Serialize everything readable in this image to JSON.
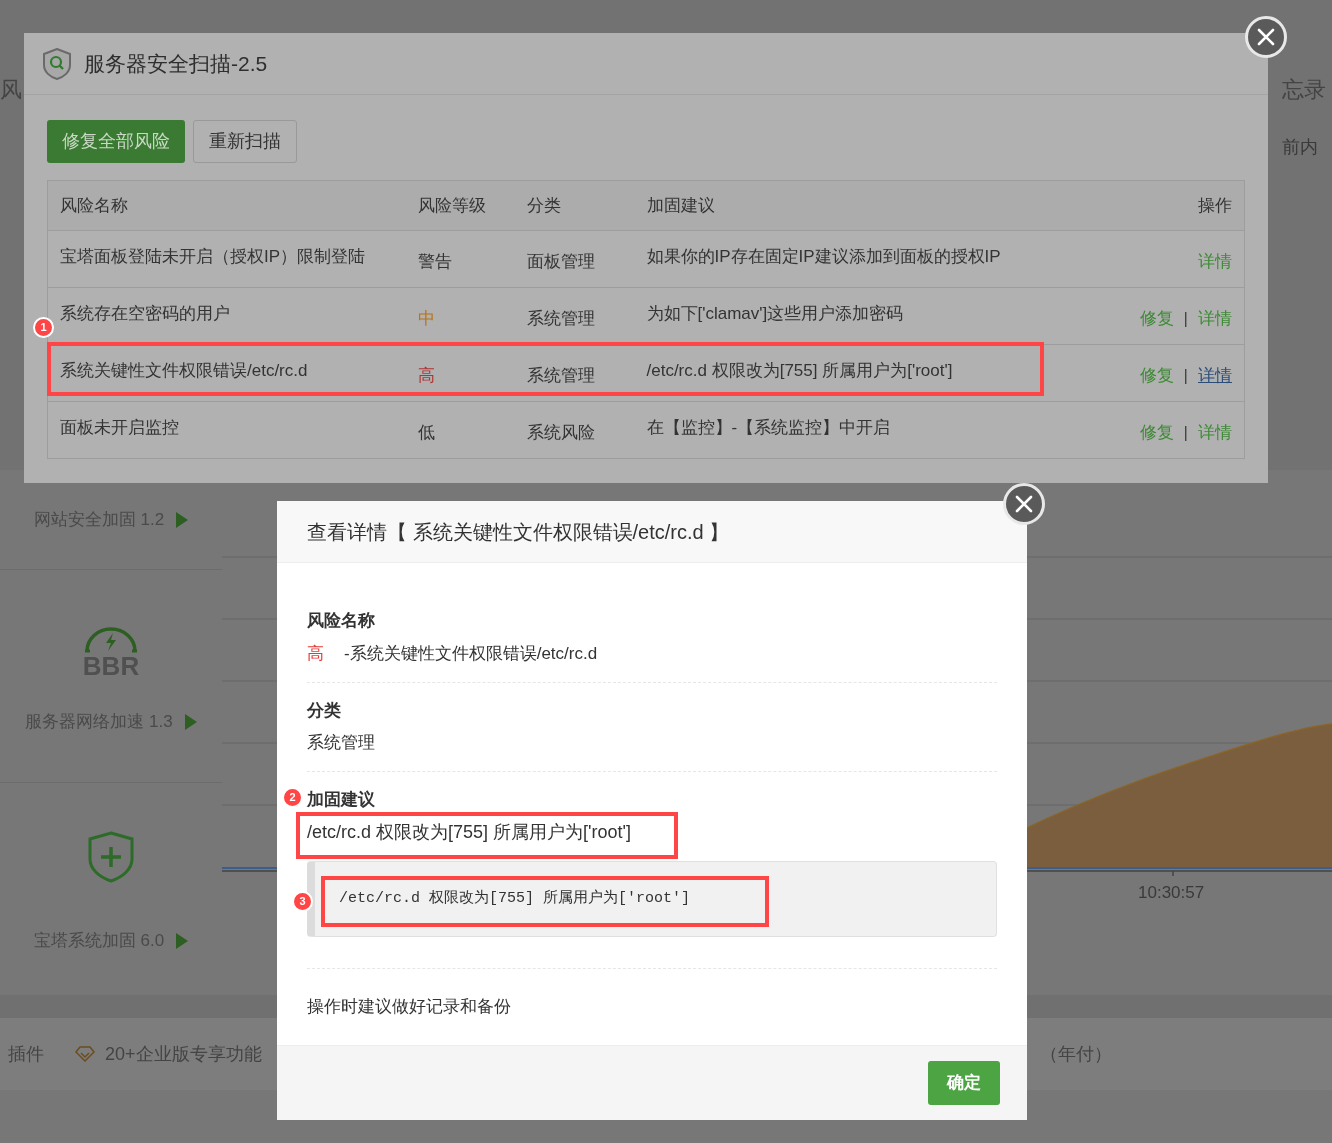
{
  "background": {
    "top_left_text": "风",
    "top_right_texts": [
      "忘录",
      "前内"
    ],
    "cards": [
      {
        "kind": "plain",
        "label": "网站安全加固 1.2"
      },
      {
        "kind": "bbr",
        "icon_text": "BBR",
        "label": "服务器网络加速 1.3"
      },
      {
        "kind": "shield",
        "label": "宝塔系统加固 6.0"
      }
    ],
    "chart": {
      "time_label": "10:30:57"
    },
    "bottom_bar": [
      {
        "kind": "text",
        "text": "插件"
      },
      {
        "kind": "diamond",
        "text": "20+企业版专享功能"
      },
      {
        "kind": "text",
        "text": "（年付）"
      }
    ]
  },
  "scan_dialog": {
    "title": "服务器安全扫描-2.5",
    "buttons": [
      {
        "kind": "primary",
        "label": "修复全部风险"
      },
      {
        "kind": "default",
        "label": "重新扫描"
      }
    ],
    "table": {
      "columns": [
        "风险名称",
        "风险等级",
        "分类",
        "加固建议",
        "操作"
      ],
      "rows": [
        {
          "name": "宝塔面板登陆未开启（授权IP）限制登陆",
          "level": "警告",
          "color": "#333333",
          "category": "面板管理",
          "suggestion": "如果你的IP存在固定IP建议添加到面板的授权IP",
          "actions": [
            {
              "label": "详情",
              "selected": false
            }
          ]
        },
        {
          "name": "系统存在空密码的用户",
          "level": "中",
          "color": "#b8741a",
          "category": "系统管理",
          "suggestion": "为如下['clamav']这些用户添加密码",
          "separator": "|",
          "actions": [
            {
              "label": "修复",
              "selected": false
            },
            {
              "label": "详情",
              "selected": false
            }
          ]
        },
        {
          "name": "系统关键性文件权限错误/etc/rc.d",
          "level": "高",
          "color": "#b03434",
          "category": "系统管理",
          "suggestion": "/etc/rc.d 权限改为[755] 所属用户为['root']",
          "separator": "|",
          "actions": [
            {
              "label": "修复",
              "selected": false
            },
            {
              "label": "详情",
              "selected": true
            }
          ]
        },
        {
          "name": "面板未开启监控",
          "level": "低",
          "color": "#333333",
          "category": "系统风险",
          "suggestion": "在【监控】-【系统监控】中开启",
          "separator": "|",
          "actions": [
            {
              "label": "修复",
              "selected": false
            },
            {
              "label": "详情",
              "selected": false
            }
          ]
        }
      ]
    }
  },
  "detail_dialog": {
    "title": "查看详情【 系统关键性文件权限错误/etc/rc.d 】",
    "sections": [
      {
        "kind": "level",
        "heading": "风险名称",
        "level": "高",
        "color": "#e53935",
        "text": "-系统关键性文件权限错误/etc/rc.d"
      },
      {
        "kind": "text",
        "heading": "分类",
        "text": "系统管理"
      },
      {
        "kind": "code",
        "heading": "加固建议",
        "text": "/etc/rc.d 权限改为[755] 所属用户为['root']",
        "code": "/etc/rc.d 权限改为[755] 所属用户为['root']"
      }
    ],
    "note": "操作时建议做好记录和备份",
    "confirm": "确定"
  },
  "annotations": [
    {
      "label": "1"
    },
    {
      "label": "2"
    },
    {
      "label": "3"
    }
  ]
}
